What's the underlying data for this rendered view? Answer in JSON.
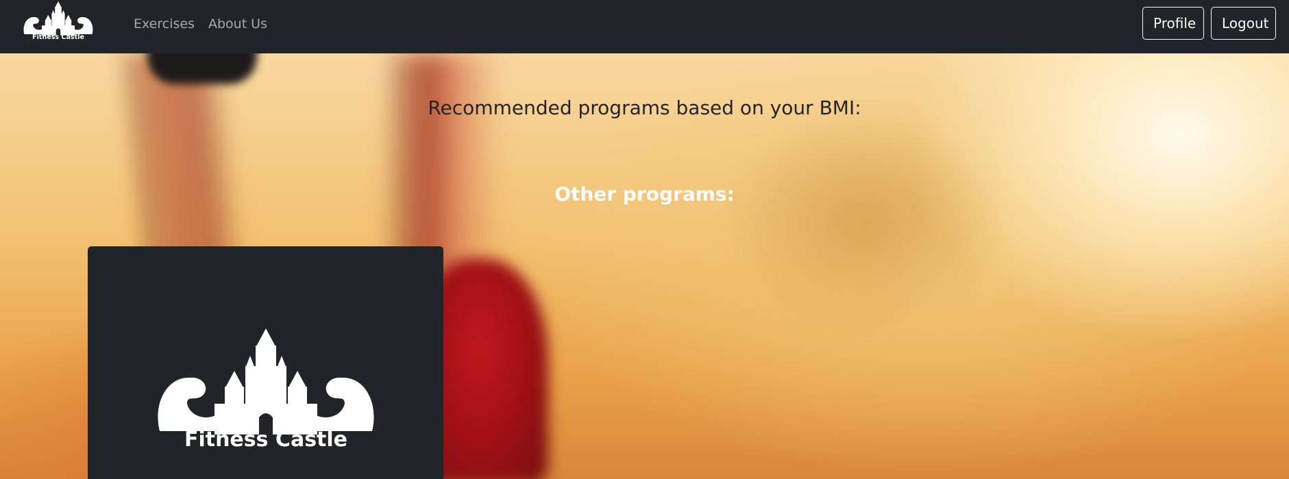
{
  "navbar": {
    "brand_name": "Fitness Castle",
    "links": [
      "Exercises",
      "About Us"
    ],
    "profile_label": "Profile",
    "logout_label": "Logout"
  },
  "main": {
    "recommended_heading": "Recommended programs based on your BMI:",
    "other_heading": "Other programs:"
  },
  "program_card": {
    "logo_text": "Fitness Castle"
  },
  "colors": {
    "navbar_bg": "#212529",
    "card_bg": "#212529",
    "nav_link": "rgba(255,255,255,0.6)"
  }
}
